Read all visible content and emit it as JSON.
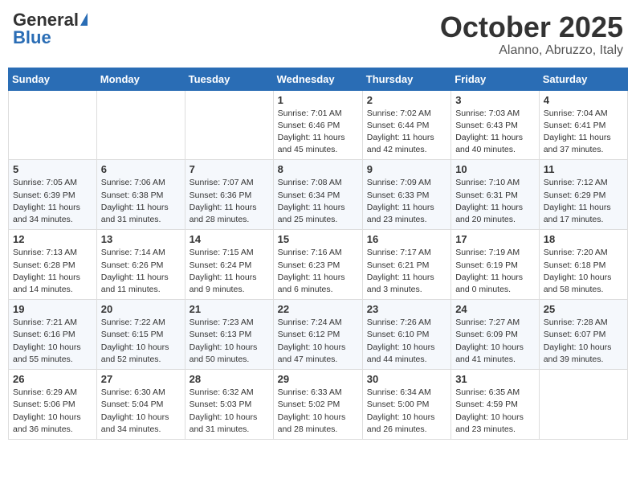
{
  "header": {
    "logo_general": "General",
    "logo_blue": "Blue",
    "month": "October 2025",
    "location": "Alanno, Abruzzo, Italy"
  },
  "weekdays": [
    "Sunday",
    "Monday",
    "Tuesday",
    "Wednesday",
    "Thursday",
    "Friday",
    "Saturday"
  ],
  "weeks": [
    [
      {
        "day": "",
        "info": ""
      },
      {
        "day": "",
        "info": ""
      },
      {
        "day": "",
        "info": ""
      },
      {
        "day": "1",
        "info": "Sunrise: 7:01 AM\nSunset: 6:46 PM\nDaylight: 11 hours and 45 minutes."
      },
      {
        "day": "2",
        "info": "Sunrise: 7:02 AM\nSunset: 6:44 PM\nDaylight: 11 hours and 42 minutes."
      },
      {
        "day": "3",
        "info": "Sunrise: 7:03 AM\nSunset: 6:43 PM\nDaylight: 11 hours and 40 minutes."
      },
      {
        "day": "4",
        "info": "Sunrise: 7:04 AM\nSunset: 6:41 PM\nDaylight: 11 hours and 37 minutes."
      }
    ],
    [
      {
        "day": "5",
        "info": "Sunrise: 7:05 AM\nSunset: 6:39 PM\nDaylight: 11 hours and 34 minutes."
      },
      {
        "day": "6",
        "info": "Sunrise: 7:06 AM\nSunset: 6:38 PM\nDaylight: 11 hours and 31 minutes."
      },
      {
        "day": "7",
        "info": "Sunrise: 7:07 AM\nSunset: 6:36 PM\nDaylight: 11 hours and 28 minutes."
      },
      {
        "day": "8",
        "info": "Sunrise: 7:08 AM\nSunset: 6:34 PM\nDaylight: 11 hours and 25 minutes."
      },
      {
        "day": "9",
        "info": "Sunrise: 7:09 AM\nSunset: 6:33 PM\nDaylight: 11 hours and 23 minutes."
      },
      {
        "day": "10",
        "info": "Sunrise: 7:10 AM\nSunset: 6:31 PM\nDaylight: 11 hours and 20 minutes."
      },
      {
        "day": "11",
        "info": "Sunrise: 7:12 AM\nSunset: 6:29 PM\nDaylight: 11 hours and 17 minutes."
      }
    ],
    [
      {
        "day": "12",
        "info": "Sunrise: 7:13 AM\nSunset: 6:28 PM\nDaylight: 11 hours and 14 minutes."
      },
      {
        "day": "13",
        "info": "Sunrise: 7:14 AM\nSunset: 6:26 PM\nDaylight: 11 hours and 11 minutes."
      },
      {
        "day": "14",
        "info": "Sunrise: 7:15 AM\nSunset: 6:24 PM\nDaylight: 11 hours and 9 minutes."
      },
      {
        "day": "15",
        "info": "Sunrise: 7:16 AM\nSunset: 6:23 PM\nDaylight: 11 hours and 6 minutes."
      },
      {
        "day": "16",
        "info": "Sunrise: 7:17 AM\nSunset: 6:21 PM\nDaylight: 11 hours and 3 minutes."
      },
      {
        "day": "17",
        "info": "Sunrise: 7:19 AM\nSunset: 6:19 PM\nDaylight: 11 hours and 0 minutes."
      },
      {
        "day": "18",
        "info": "Sunrise: 7:20 AM\nSunset: 6:18 PM\nDaylight: 10 hours and 58 minutes."
      }
    ],
    [
      {
        "day": "19",
        "info": "Sunrise: 7:21 AM\nSunset: 6:16 PM\nDaylight: 10 hours and 55 minutes."
      },
      {
        "day": "20",
        "info": "Sunrise: 7:22 AM\nSunset: 6:15 PM\nDaylight: 10 hours and 52 minutes."
      },
      {
        "day": "21",
        "info": "Sunrise: 7:23 AM\nSunset: 6:13 PM\nDaylight: 10 hours and 50 minutes."
      },
      {
        "day": "22",
        "info": "Sunrise: 7:24 AM\nSunset: 6:12 PM\nDaylight: 10 hours and 47 minutes."
      },
      {
        "day": "23",
        "info": "Sunrise: 7:26 AM\nSunset: 6:10 PM\nDaylight: 10 hours and 44 minutes."
      },
      {
        "day": "24",
        "info": "Sunrise: 7:27 AM\nSunset: 6:09 PM\nDaylight: 10 hours and 41 minutes."
      },
      {
        "day": "25",
        "info": "Sunrise: 7:28 AM\nSunset: 6:07 PM\nDaylight: 10 hours and 39 minutes."
      }
    ],
    [
      {
        "day": "26",
        "info": "Sunrise: 6:29 AM\nSunset: 5:06 PM\nDaylight: 10 hours and 36 minutes."
      },
      {
        "day": "27",
        "info": "Sunrise: 6:30 AM\nSunset: 5:04 PM\nDaylight: 10 hours and 34 minutes."
      },
      {
        "day": "28",
        "info": "Sunrise: 6:32 AM\nSunset: 5:03 PM\nDaylight: 10 hours and 31 minutes."
      },
      {
        "day": "29",
        "info": "Sunrise: 6:33 AM\nSunset: 5:02 PM\nDaylight: 10 hours and 28 minutes."
      },
      {
        "day": "30",
        "info": "Sunrise: 6:34 AM\nSunset: 5:00 PM\nDaylight: 10 hours and 26 minutes."
      },
      {
        "day": "31",
        "info": "Sunrise: 6:35 AM\nSunset: 4:59 PM\nDaylight: 10 hours and 23 minutes."
      },
      {
        "day": "",
        "info": ""
      }
    ]
  ]
}
